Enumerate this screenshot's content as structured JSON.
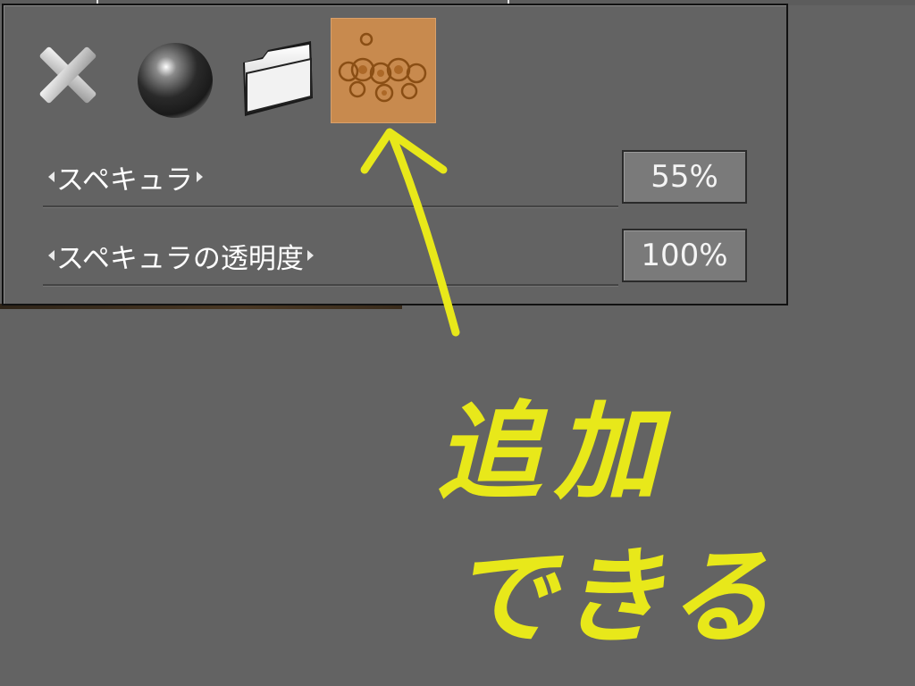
{
  "toolbar": {
    "icons": [
      {
        "name": "close-icon",
        "tooltip": ""
      },
      {
        "name": "sphere-icon",
        "tooltip": ""
      },
      {
        "name": "folder-icon",
        "tooltip": ""
      },
      {
        "name": "texture-thumbnail-icon",
        "tooltip": ""
      }
    ]
  },
  "params": {
    "specular": {
      "label": "スペキュラ",
      "value": "55%"
    },
    "specular_opacity": {
      "label": "スペキュラの透明度",
      "value": "100%"
    }
  },
  "annotation": {
    "line1": "追加",
    "line2": "できる",
    "color": "#e8e81a"
  },
  "colors": {
    "background": "#636363",
    "texture_swatch": "#c88a4e",
    "annotation": "#e8e81a"
  }
}
